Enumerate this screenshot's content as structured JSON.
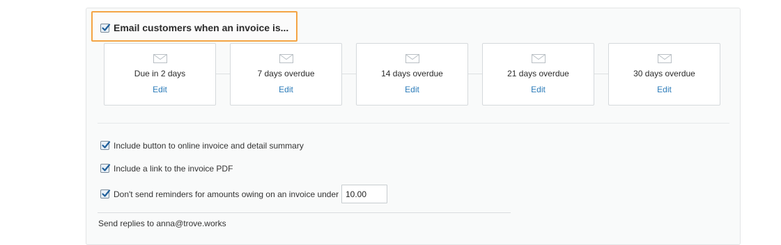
{
  "header": {
    "label": "Email customers when an invoice is..."
  },
  "reminders": [
    {
      "title": "Due in 2 days",
      "edit": "Edit"
    },
    {
      "title": "7 days overdue",
      "edit": "Edit"
    },
    {
      "title": "14 days overdue",
      "edit": "Edit"
    },
    {
      "title": "21 days overdue",
      "edit": "Edit"
    },
    {
      "title": "30 days overdue",
      "edit": "Edit"
    }
  ],
  "options": {
    "include_button": "Include button to online invoice and detail summary",
    "include_pdf": "Include a link to the invoice PDF",
    "dont_send_under": "Don't send reminders for amounts owing on an invoice under",
    "amount_value": "10.00"
  },
  "replies": {
    "text": "Send replies to anna@trove.works"
  },
  "colors": {
    "highlight": "#f4a444",
    "link": "#2b7bb9",
    "check": "#1f5f9a"
  }
}
